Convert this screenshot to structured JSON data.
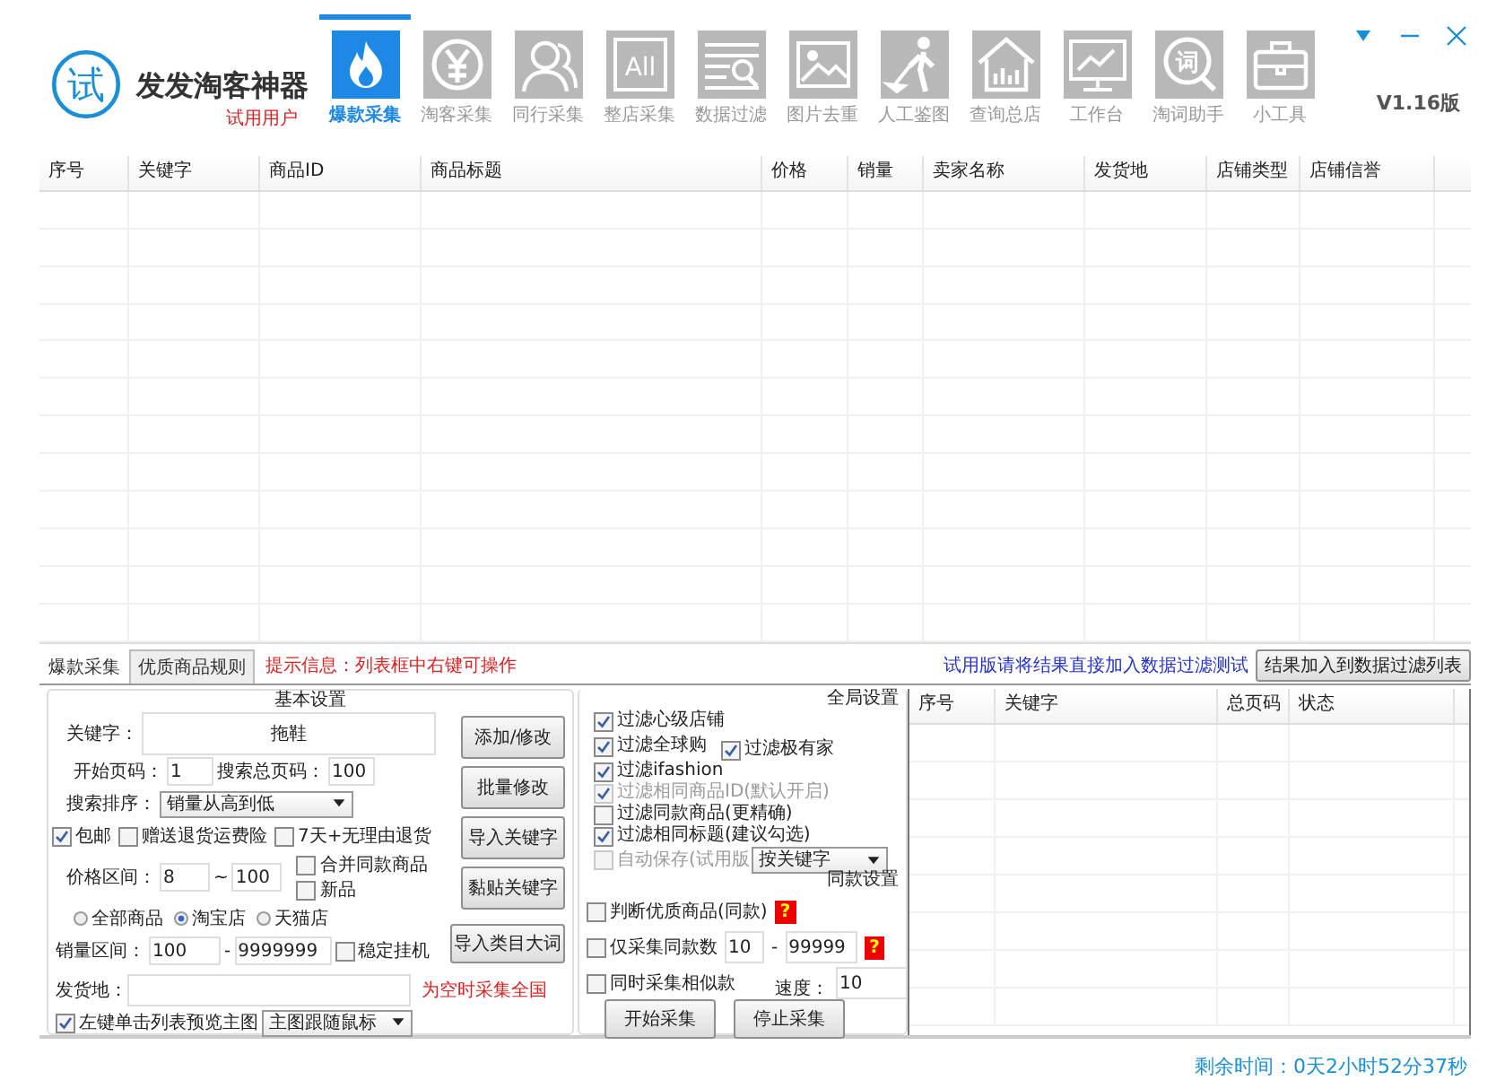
{
  "app": {
    "logo_text": "试",
    "title": "发发淘客神器",
    "subtitle": "试用用户",
    "version": "V1.16版"
  },
  "toolbar": [
    {
      "label": "爆款采集",
      "selected": true
    },
    {
      "label": "淘客采集",
      "selected": false
    },
    {
      "label": "同行采集",
      "selected": false
    },
    {
      "label": "整店采集",
      "selected": false,
      "icon_text": "All"
    },
    {
      "label": "数据过滤",
      "selected": false
    },
    {
      "label": "图片去重",
      "selected": false
    },
    {
      "label": "人工鉴图",
      "selected": false
    },
    {
      "label": "查询总店",
      "selected": false
    },
    {
      "label": "工作台",
      "selected": false
    },
    {
      "label": "淘词助手",
      "selected": false,
      "icon_text": "词"
    },
    {
      "label": "小工具",
      "selected": false
    }
  ],
  "results_table": {
    "columns": [
      "序号",
      "关键字",
      "商品ID",
      "商品标题",
      "价格",
      "销量",
      "卖家名称",
      "发货地",
      "店铺类型",
      "店铺信誉"
    ]
  },
  "bottom_tabs": [
    {
      "label": "爆款采集",
      "selected": true
    },
    {
      "label": "优质商品规则",
      "selected": false
    }
  ],
  "hint": "提示信息：列表框中右键可操作",
  "trial_note": "试用版请将结果直接加入数据过滤测试",
  "add_to_filter_button": "结果加入到数据过滤列表",
  "basic_settings": {
    "title": "基本设置",
    "keyword": {
      "label": "关键字：",
      "value": "拖鞋"
    },
    "start_page": {
      "label": "开始页码：",
      "value": "1"
    },
    "total_pages": {
      "label": "搜索总页码：",
      "value": "100"
    },
    "sort": {
      "label": "搜索排序：",
      "value": "销量从高到低"
    },
    "options": [
      {
        "label": "包邮",
        "checked": true
      },
      {
        "label": "赠送退货运费险",
        "checked": false
      },
      {
        "label": "7天+无理由退货",
        "checked": false
      }
    ],
    "price_range": {
      "label": "价格区间：",
      "from": "8",
      "separator": "~",
      "to": "100"
    },
    "extra_options": [
      {
        "label": "合并同款商品",
        "checked": false
      },
      {
        "label": "新品",
        "checked": false
      }
    ],
    "shop_types": [
      {
        "label": "全部商品",
        "selected": false
      },
      {
        "label": "淘宝店",
        "selected": true
      },
      {
        "label": "天猫店",
        "selected": false
      }
    ],
    "sales_range": {
      "label": "销量区间：",
      "from": "100",
      "separator": "-",
      "to": "9999999"
    },
    "stable_mode": {
      "label": "稳定挂机",
      "checked": false
    },
    "buttons": [
      "添加/修改",
      "批量修改",
      "导入关键字",
      "黏贴关键字",
      "导入类目大词"
    ],
    "ship_from": {
      "label": "发货地：",
      "note": "为空时采集全国"
    },
    "preview": {
      "label": "左键单击列表预览主图",
      "checked": true,
      "mode": "主图跟随鼠标"
    }
  },
  "global_settings": {
    "title": "全局设置",
    "filters": [
      {
        "label": "过滤心级店铺",
        "checked": true,
        "disabled": false
      },
      {
        "label": "过滤全球购",
        "checked": true,
        "disabled": false
      },
      {
        "label": "过滤极有家",
        "checked": true,
        "disabled": false
      },
      {
        "label": "过滤ifashion",
        "checked": true,
        "disabled": false
      },
      {
        "label": "过滤相同商品ID(默认开启)",
        "checked": true,
        "disabled": true
      },
      {
        "label": "过滤同款商品(更精确)",
        "checked": false,
        "disabled": false
      },
      {
        "label": "过滤相同标题(建议勾选)",
        "checked": true,
        "disabled": false
      },
      {
        "label": "自动保存(试用版",
        "checked": false,
        "disabled": true
      }
    ],
    "save_mode": "按关键字",
    "same_title": "同款设置",
    "judge_quality": {
      "label": "判断优质商品(同款)",
      "checked": false,
      "help": "?"
    },
    "same_count": {
      "label": "仅采集同款数",
      "checked": false,
      "from": "10",
      "separator": "-",
      "to": "99999",
      "help": "?"
    },
    "similar": {
      "label": "同时采集相似款",
      "checked": false
    },
    "speed": {
      "label": "速度：",
      "value": "10"
    },
    "buttons": [
      "开始采集",
      "停止采集"
    ]
  },
  "keyword_table": {
    "columns": [
      "序号",
      "关键字",
      "总页码",
      "状态"
    ]
  },
  "status": "剩余时间：0天2小时52分37秒"
}
